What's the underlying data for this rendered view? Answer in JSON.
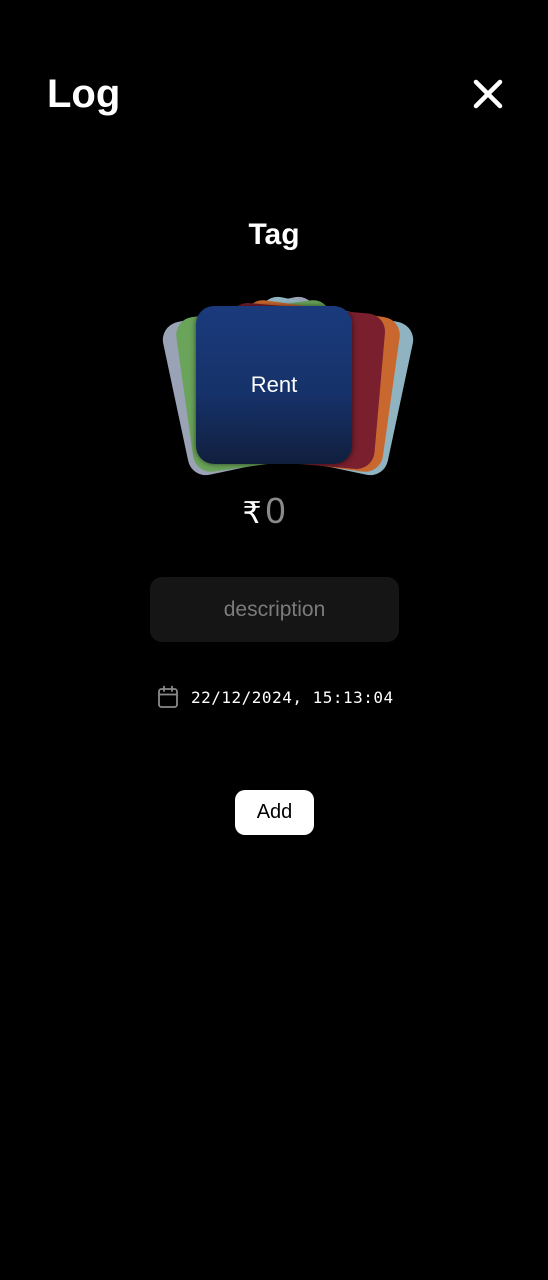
{
  "header": {
    "title": "Log",
    "close_icon": "close-icon"
  },
  "tag_section": {
    "heading": "Tag",
    "selected_tag": "Rent",
    "card_colors": [
      "#1a3a7c",
      "#7a1f2e",
      "#c8672e",
      "#8fb3c0",
      "#6aa35a",
      "#9aa3b5"
    ]
  },
  "amount": {
    "currency_symbol": "₹",
    "placeholder": "0"
  },
  "description": {
    "placeholder": "description"
  },
  "datetime": {
    "icon": "calendar-icon",
    "value": "22/12/2024, 15:13:04"
  },
  "actions": {
    "add_label": "Add"
  }
}
